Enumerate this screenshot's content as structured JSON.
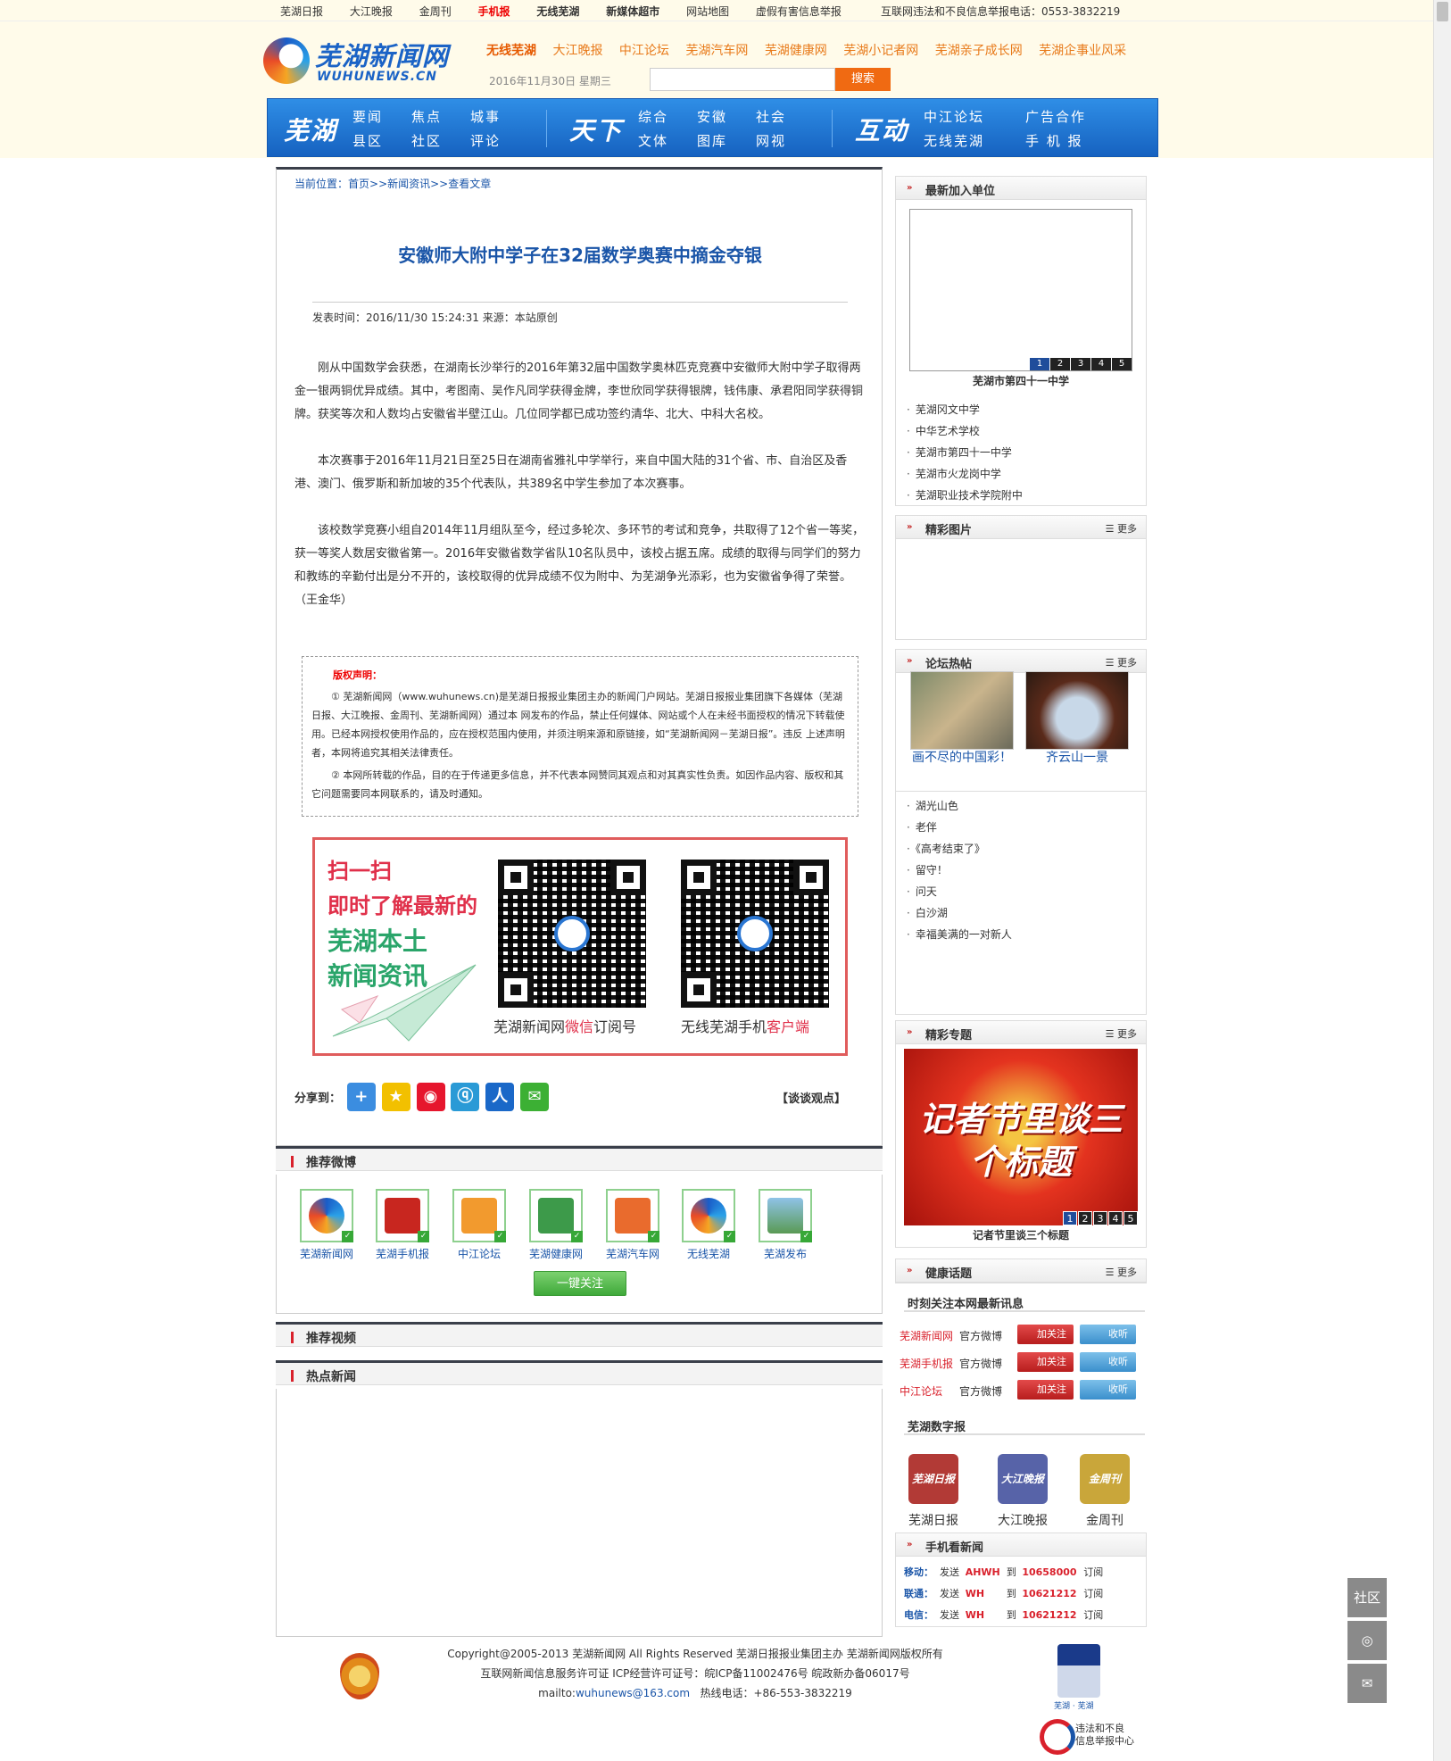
{
  "topbar": {
    "links": [
      "芜湖日报",
      "大江晚报",
      "金周刊",
      "手机报",
      "无线芜湖",
      "新媒体超市",
      "网站地图",
      "虚假有害信息举报"
    ],
    "hotline": "互联网违法和不良信息举报电话：0553-3832219"
  },
  "header": {
    "logo_cn": "芜湖新闻网",
    "logo_en": "WUHUNEWS.CN",
    "sites": [
      "无线芜湖",
      "大江晚报",
      "中江论坛",
      "芜湖汽车网",
      "芜湖健康网",
      "芜湖小记者网",
      "芜湖亲子成长网",
      "芜湖企事业风采"
    ],
    "date": "2016年11月30日 星期三",
    "search_placeholder": "",
    "search_button": "搜索"
  },
  "nav": {
    "groups": [
      {
        "big": "芜湖",
        "items": [
          "要闻",
          "焦点",
          "城事",
          "县区",
          "社区",
          "评论"
        ]
      },
      {
        "big": "天下",
        "items": [
          "综合",
          "安徽",
          "社会",
          "文体",
          "图库",
          "网视"
        ]
      },
      {
        "big": "互动",
        "items": [
          "中江论坛",
          "广告合作",
          "无线芜湖",
          "手 机 报"
        ]
      }
    ]
  },
  "breadcrumb": {
    "label": "当前位置：",
    "path": "首页>>新闻资讯>>查看文章"
  },
  "article": {
    "title": "安徽师大附中学子在32届数学奥赛中摘金夺银",
    "meta": "发表时间：2016/11/30 15:24:31 来源：本站原创",
    "paragraphs": [
      "刚从中国数学会获悉，在湖南长沙举行的2016年第32届中国数学奥林匹克竞赛中安徽师大附中学子取得两金一银两铜优异成绩。其中，考图南、吴作凡同学获得金牌，李世欣同学获得银牌，钱伟康、承君阳同学获得铜牌。获奖等次和人数均占安徽省半壁江山。几位同学都已成功签约清华、北大、中科大名校。",
      "本次赛事于2016年11月21日至25日在湖南省雅礼中学举行，来自中国大陆的31个省、市、自治区及香港、澳门、俄罗斯和新加坡的35个代表队，共389名中学生参加了本次赛事。",
      "该校数学竞赛小组自2014年11月组队至今，经过多轮次、多环节的考试和竞争，共取得了12个省一等奖，获一等奖人数居安徽省第一。2016年安徽省数学省队10名队员中，该校占据五席。成绩的取得与同学们的努力和教练的辛勤付出是分不开的，该校取得的优异成绩不仅为附中、为芜湖争光添彩，也为安徽省争得了荣誉。（王金华）"
    ]
  },
  "notice": {
    "title": "版权声明：",
    "p1": "① 芜湖新闻网（www.wuhunews.cn)是芜湖日报报业集团主办的新闻门户网站。芜湖日报报业集团旗下各媒体（芜湖日报、大江晚报、金周刊、芜湖新闻网）通过本 网发布的作品，禁止任何媒体、网站或个人在未经书面授权的情况下转载使用。已经本网授权使用作品的，应在授权范围内使用，并须注明来源和原链接，如“芜湖新闻网－芜湖日报”。违反 上述声明者，本网将追究其相关法律责任。",
    "p2": "② 本网所转载的作品，目的在于传递更多信息，并不代表本网赞同其观点和对其真实性负责。如因作品内容、版权和其它问题需要同本网联系的，请及时通知。"
  },
  "qr": {
    "slogan": [
      "扫一扫",
      "即时了解最新的",
      "芜湖本土",
      "新闻资讯"
    ],
    "cap1_pre": "芜湖新闻网",
    "cap1_em": "微信",
    "cap1_post": "订阅号",
    "cap2_pre": "无线芜湖手机",
    "cap2_em": "客户端"
  },
  "share": {
    "label": "分享到：",
    "icons": [
      "plus-share-icon",
      "qzone-icon",
      "weibo-icon",
      "tencent-weibo-icon",
      "renren-icon",
      "wechat-icon"
    ],
    "discuss": "【谈谈观点】"
  },
  "sections": {
    "weibo": "推荐微博",
    "video": "推荐视频",
    "hot": "热点新闻"
  },
  "weibo_accounts": [
    "芜湖新闻网",
    "芜湖手机报",
    "中江论坛",
    "芜湖健康网",
    "芜湖汽车网",
    "无线芜湖",
    "芜湖发布"
  ],
  "follow_all": "一键关注",
  "sidebar": {
    "new_units": {
      "title": "最新加入单位",
      "slide_nums": [
        "1",
        "2",
        "3",
        "4",
        "5"
      ],
      "slide_caption": "芜湖市第四十一中学",
      "items": [
        "芜湖冈文中学",
        "中华艺术学校",
        "芜湖市第四十一中学",
        "芜湖市火龙岗中学",
        "芜湖职业技术学院附中"
      ]
    },
    "photos": {
      "title": "精彩图片",
      "more": "更多"
    },
    "forum": {
      "title": "论坛热帖",
      "more": "更多",
      "pics": [
        "画不尽的中国彩！",
        "齐云山一景"
      ],
      "items": [
        "湖光山色",
        "老伴",
        "《高考结束了》",
        "留守！",
        "问天",
        "白沙湖",
        "幸福美满的一对新人"
      ]
    },
    "special": {
      "title": "精彩专题",
      "more": "更多",
      "banner": "记者节里谈三个标题",
      "caption": "记者节里谈三个标题",
      "nums": [
        "1",
        "2",
        "3",
        "4",
        "5"
      ]
    },
    "health": {
      "title": "健康话题",
      "more": "更多"
    },
    "follow": {
      "title": "时刻关注本网最新讯息",
      "rows": [
        {
          "name": "芜湖新闻网",
          "of": "官方微博",
          "add": "加关注",
          "listen": "收听"
        },
        {
          "name": "芜湖手机报",
          "of": "官方微博",
          "add": "加关注",
          "listen": "收听"
        },
        {
          "name": "中江论坛",
          "of": "官方微博",
          "add": "加关注",
          "listen": "收听"
        }
      ]
    },
    "digital": {
      "title": "芜湖数字报",
      "papers": [
        {
          "name": "芜湖日报",
          "cover": "芜湖日报"
        },
        {
          "name": "大江晚报",
          "cover": "大江晚报"
        },
        {
          "name": "金周刊",
          "cover": "金周刊"
        }
      ]
    },
    "mobile": {
      "title": "手机看新闻",
      "rows": [
        {
          "op": "移动：",
          "send": "发送",
          "kw": "AHWH",
          "to": "到",
          "num": "10658000",
          "sub": "订阅"
        },
        {
          "op": "联通：",
          "send": "发送",
          "kw": "WH",
          "to": "到",
          "num": "10621212",
          "sub": "订阅"
        },
        {
          "op": "电信：",
          "send": "发送",
          "kw": "WH",
          "to": "到",
          "num": "10621212",
          "sub": "订阅"
        }
      ]
    }
  },
  "footer": {
    "line1": "Copyright@2005-2013 芜湖新闻网  All Rights Reserved 芜湖日报报业集团主办  芜湖新闻网版权所有",
    "line2": "互联网新闻信息服务许可证  ICP经营许可证号：皖ICP备11002476号  皖政新办备06017号",
    "mail_label": "mailto:",
    "mail": "wuhunews@163.com",
    "tel": "热线电话：+86-553-3832219",
    "badge_sub": "芜湖 · 芜湖",
    "report": [
      "违法和不良",
      "信息举报中心"
    ]
  },
  "floating": {
    "community": "社区"
  }
}
